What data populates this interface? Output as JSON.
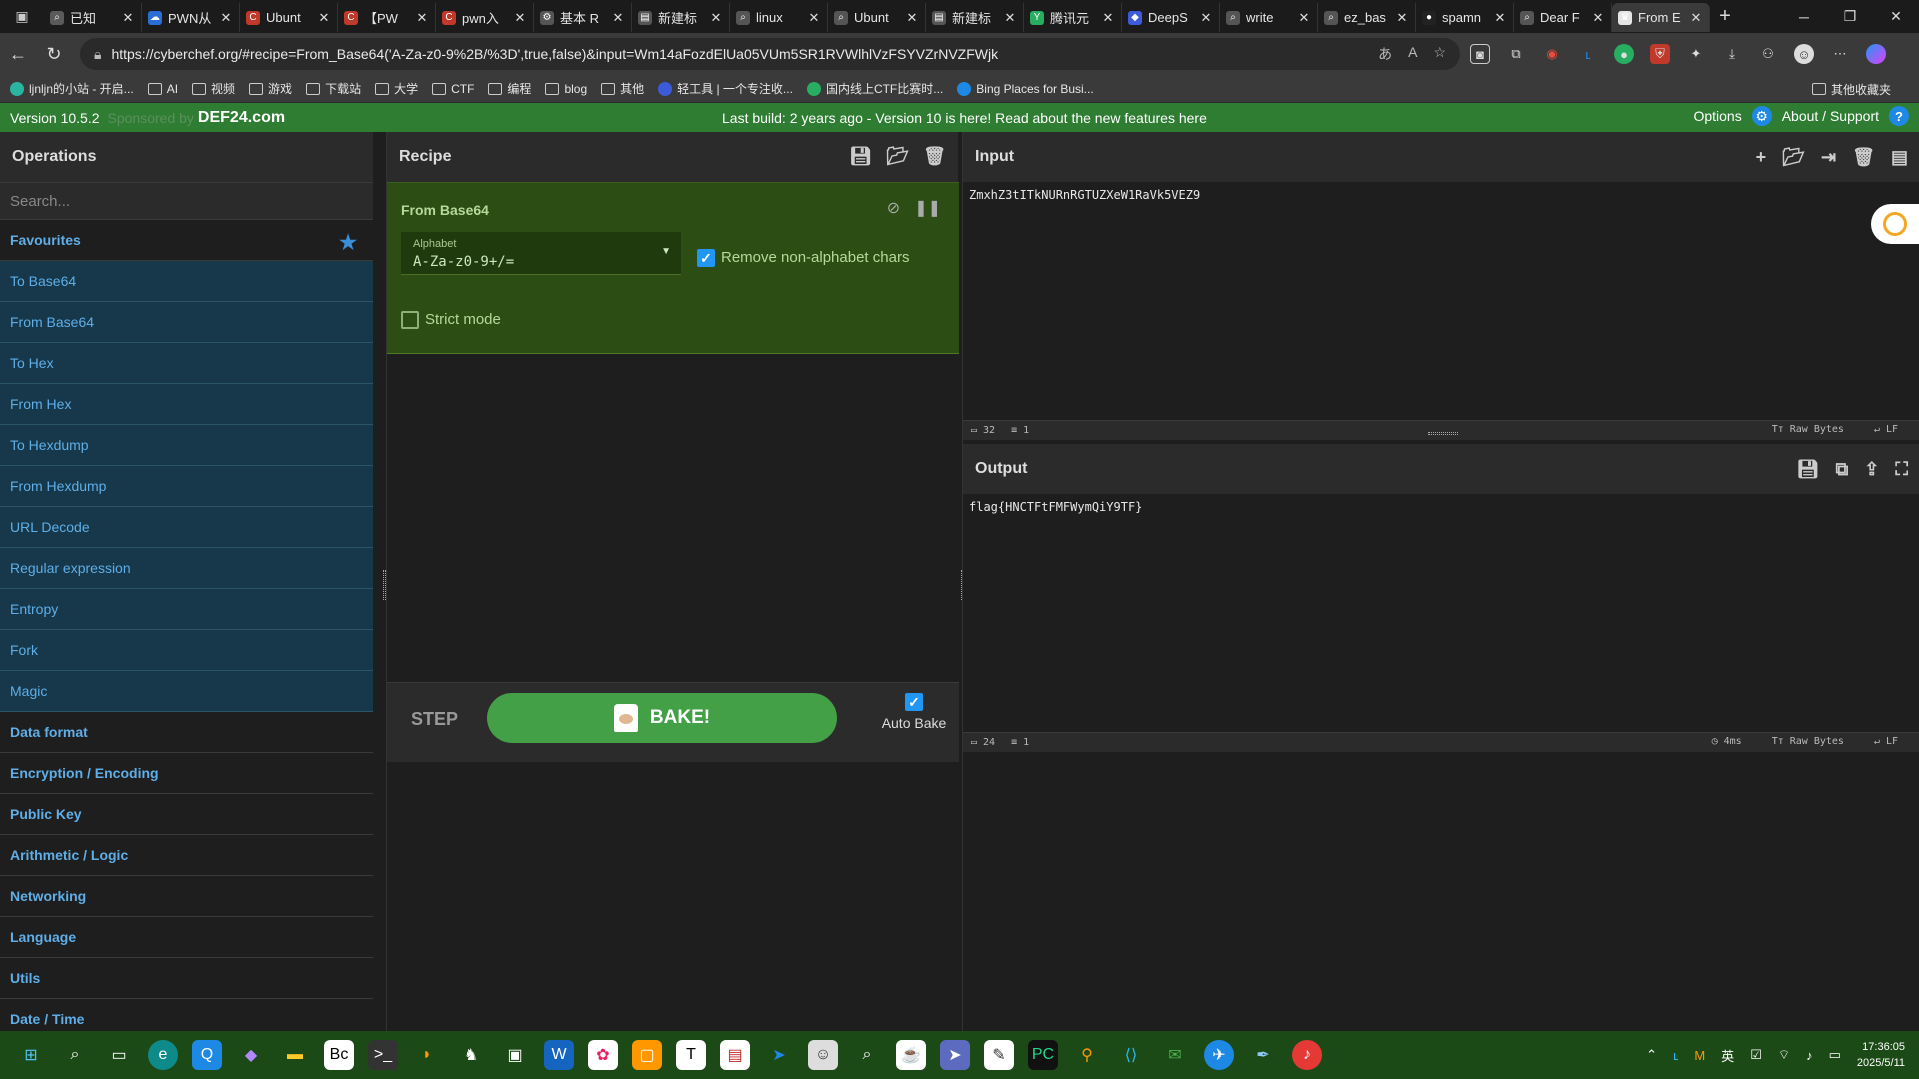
{
  "browser": {
    "tabs": [
      {
        "title": "已知",
        "color": "#5a5a5a",
        "icon": "search"
      },
      {
        "title": "PWN从",
        "color": "#2a6fd6",
        "icon": "cloud"
      },
      {
        "title": "Ubunt",
        "color": "#c0392b",
        "icon": "c"
      },
      {
        "title": "【PW",
        "color": "#c0392b",
        "icon": "c"
      },
      {
        "title": "pwn入",
        "color": "#c0392b",
        "icon": "c"
      },
      {
        "title": "基本 R",
        "color": "#555",
        "icon": "gear"
      },
      {
        "title": "新建标",
        "color": "#555",
        "icon": "page"
      },
      {
        "title": "linux",
        "color": "#555",
        "icon": "search"
      },
      {
        "title": "Ubunt",
        "color": "#555",
        "icon": "search"
      },
      {
        "title": "新建标",
        "color": "#555",
        "icon": "page"
      },
      {
        "title": "腾讯元",
        "color": "#27ae60",
        "icon": "y"
      },
      {
        "title": "DeepS",
        "color": "#3b5bdb",
        "icon": "whale"
      },
      {
        "title": "write",
        "color": "#555",
        "icon": "search"
      },
      {
        "title": "ez_bas",
        "color": "#555",
        "icon": "search"
      },
      {
        "title": "spamn",
        "color": "#222",
        "icon": "dot"
      },
      {
        "title": "Dear F",
        "color": "#555",
        "icon": "search"
      },
      {
        "title": "From E",
        "color": "#e6e6e6",
        "icon": "chef",
        "active": true
      }
    ],
    "url": "https://cyberchef.org/#recipe=From_Base64('A-Za-z0-9%2B/%3D',true,false)&input=Wm14aFozdElUa05VUm5SR1RVWlhlVzFSYVZrNVZFWjk",
    "bookmarks": [
      {
        "label": "ljnljn的小站 - 开启...",
        "kind": "circle",
        "color": "#2bb5a0"
      },
      {
        "label": "AI",
        "kind": "folder"
      },
      {
        "label": "视频",
        "kind": "folder"
      },
      {
        "label": "游戏",
        "kind": "folder"
      },
      {
        "label": "下载站",
        "kind": "folder"
      },
      {
        "label": "大学",
        "kind": "folder"
      },
      {
        "label": "CTF",
        "kind": "folder"
      },
      {
        "label": "编程",
        "kind": "folder"
      },
      {
        "label": "blog",
        "kind": "folder"
      },
      {
        "label": "其他",
        "kind": "folder"
      },
      {
        "label": "轻工具 | 一个专注收...",
        "kind": "circle",
        "color": "#3b5bdb"
      },
      {
        "label": "国内线上CTF比赛时...",
        "kind": "circle",
        "color": "#27ae60"
      },
      {
        "label": "Bing Places for Busi...",
        "kind": "circle",
        "color": "#1e88e5"
      }
    ],
    "bookmarks_right": "其他收藏夹"
  },
  "banner": {
    "version": "Version 10.5.2",
    "sponsored": "Sponsored by",
    "sponsor_name": "DEF24.com",
    "notice": "Last build: 2 years ago - Version 10 is here! Read about the new features here",
    "options": "Options",
    "about": "About / Support"
  },
  "operations": {
    "title": "Operations",
    "search_placeholder": "Search...",
    "favourites": "Favourites",
    "fav_items": [
      "To Base64",
      "From Base64",
      "To Hex",
      "From Hex",
      "To Hexdump",
      "From Hexdump",
      "URL Decode",
      "Regular expression",
      "Entropy",
      "Fork",
      "Magic"
    ],
    "categories": [
      "Data format",
      "Encryption / Encoding",
      "Public Key",
      "Arithmetic / Logic",
      "Networking",
      "Language",
      "Utils",
      "Date / Time"
    ]
  },
  "recipe": {
    "title": "Recipe",
    "op_name": "From Base64",
    "alphabet_label": "Alphabet",
    "alphabet_value": "A-Za-z0-9+/=",
    "remove_nonalpha_label": "Remove non-alphabet chars",
    "remove_nonalpha_checked": true,
    "strict_label": "Strict mode",
    "strict_checked": false,
    "step": "STEP",
    "bake": "BAKE!",
    "autobake": "Auto Bake",
    "autobake_checked": true
  },
  "input": {
    "title": "Input",
    "text": "ZmxhZ3tITkNURnRGTUZXeW1RaVk5VEZ9",
    "length": "32",
    "lines": "1",
    "encoding": "Raw Bytes",
    "eol": "LF"
  },
  "output": {
    "title": "Output",
    "text": "flag{HNCTFtFMFWymQiY9TF}",
    "length": "24",
    "lines": "1",
    "time": "4ms",
    "encoding": "Raw Bytes",
    "eol": "LF"
  },
  "taskbar": {
    "ime": "英",
    "time": "17:36:05",
    "date": "2025/5/11"
  }
}
